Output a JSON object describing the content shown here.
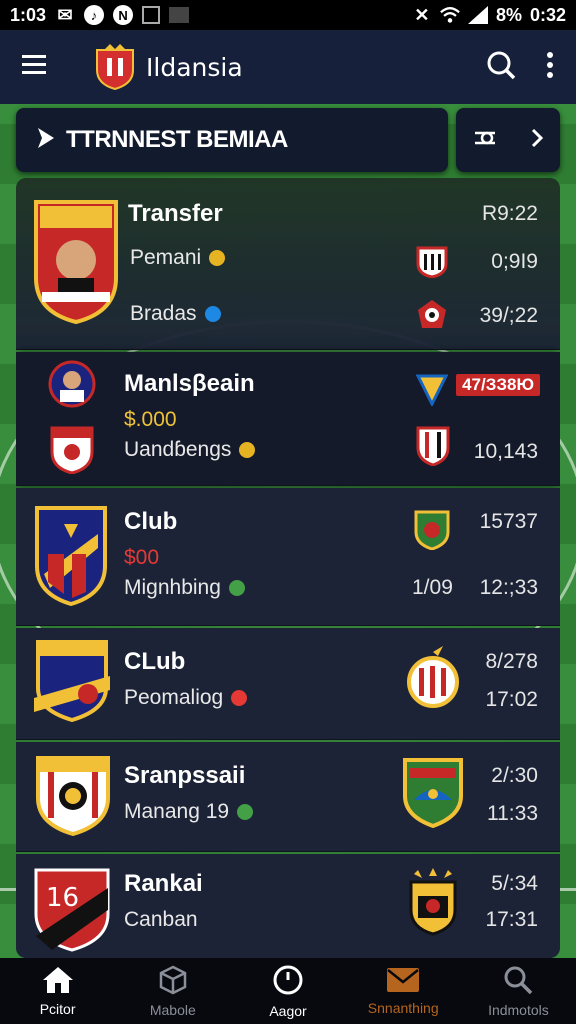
{
  "status_bar": {
    "time": "1:03",
    "battery": "8%",
    "clock": "0:32"
  },
  "app_bar": {
    "title": "Ildansia"
  },
  "banner": {
    "title": "TTRNNEST BEMIAA"
  },
  "rows": [
    {
      "name": "Transfer",
      "line2": "Pemani",
      "line3": "Bradas",
      "val1": "R9:22",
      "val2": "0;9I9",
      "val3": "39/;22"
    },
    {
      "name": "Manlsβeain",
      "money": "$.000",
      "line3": "Uandɓengs",
      "tag": "47/ЗЗ8Ю",
      "val3": "10,143"
    },
    {
      "name": "Club",
      "money": "$00",
      "line3": "Mignhbing",
      "val1": "15737",
      "val2": "1/09",
      "val3": "12:;33"
    },
    {
      "name": "CLub",
      "line2": "Peomaliog",
      "val1": "8/278",
      "val2": "17:02"
    },
    {
      "name": "Sranpssaii",
      "line2": "Manang 19",
      "val1": "2/:30",
      "val2": "11:33"
    },
    {
      "name": "Rankai",
      "line2": "Canban",
      "val1": "5/:34",
      "val2": "17:31"
    }
  ],
  "bottom_nav": [
    {
      "label": "Pcitor",
      "icon": "home-icon"
    },
    {
      "label": "Mabole",
      "icon": "cube-icon"
    },
    {
      "label": "Aagor",
      "icon": "clock-icon"
    },
    {
      "label": "Snnanthing",
      "icon": "envelope-icon"
    },
    {
      "label": "Indmotols",
      "icon": "search-icon"
    }
  ],
  "colors": {
    "appbar": "#17203a",
    "panel": "#1c2336",
    "accent_orange": "#b5651d",
    "money": "#f0c23a",
    "red": "#c62828"
  }
}
